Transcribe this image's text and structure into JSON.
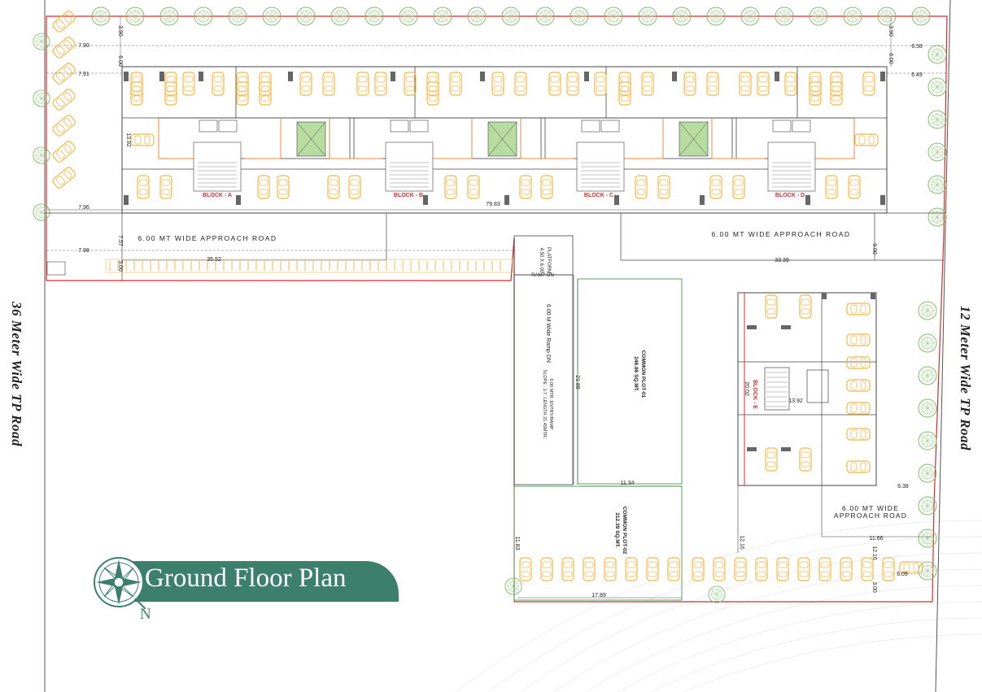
{
  "title": "Ground Floor Plan",
  "compass_letter": "N",
  "roads": {
    "left": "36 Meter Wide TP Road",
    "right": "12 Meter Wide TP Road"
  },
  "approach_road_left": "6.00 MT WIDE APPROACH ROAD",
  "approach_road_right": "6.00 MT WIDE APPROACH ROAD",
  "approach_road_bottom_1": "6.00 MT WIDE",
  "approach_road_bottom_2": "APPROACH ROAD",
  "blocks": [
    "BLOCK - A",
    "BLOCK - B",
    "BLOCK - C",
    "BLOCK - D",
    "BLOCK - E"
  ],
  "ramp": {
    "platform_1": "PLATFORM",
    "platform_2": "4.50 X 6.00",
    "ramp_dn": "RAMP DN",
    "label": "6.00 M Wide Ramp DN",
    "entry": "6.00 MTR. ENTRY/RAMP",
    "slope": "SLOPE : 1:7, LENGTH 21.45MTR."
  },
  "common_plot_1": {
    "name": "COMMON PLOT-01",
    "area": "248.86 SQ.MT."
  },
  "common_plot_2": {
    "name": "COMMON PLOT-02",
    "area": "212.39 SQ.MT."
  },
  "dimensions": {
    "d_390a": "3.90",
    "d_600a": "6.00",
    "d_790": "7.90",
    "d_791": "7.91",
    "d_1392a": "13.92",
    "d_796": "7.96",
    "d_757": "7.57",
    "d_798": "7.98",
    "d_300a": "3.00",
    "d_3552": "35.52",
    "d_7983": "79.83",
    "d_390b": "3.90",
    "d_600b": "6.00",
    "d_658": "6.58",
    "d_649": "6.49",
    "d_900": "9.00",
    "d_3339": "33.39",
    "d_2188": "21.88",
    "d_1134": "11.34",
    "d_2002": "20.02",
    "d_1392b": "13.92",
    "d_638": "6.38",
    "d_1166": "11.66",
    "d_1216a": "12.16",
    "d_1216b": "12.16",
    "d_1183": "11.83",
    "d_609": "6.09",
    "d_300b": "3.00",
    "d_1789": "17.89"
  }
}
